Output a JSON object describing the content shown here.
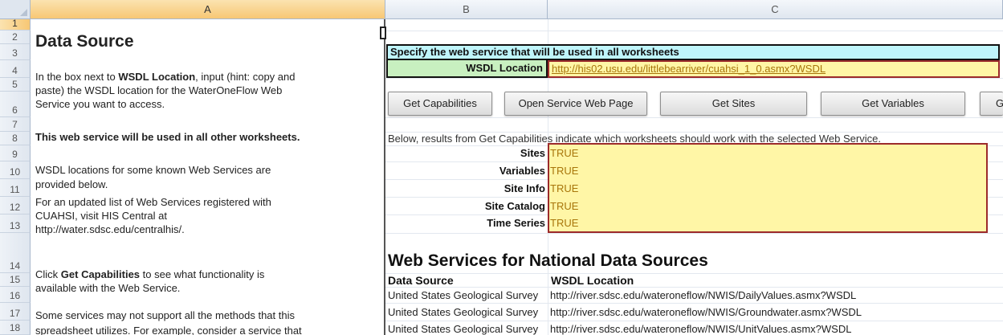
{
  "columns": [
    {
      "label": "A",
      "selected": true
    },
    {
      "label": "B",
      "selected": false
    },
    {
      "label": "C",
      "selected": false
    }
  ],
  "rows": [
    "1",
    "2",
    "3",
    "4",
    "5",
    "6",
    "7",
    "8",
    "9",
    "10",
    "11",
    "12",
    "13",
    "14",
    "15",
    "16",
    "17",
    "18"
  ],
  "left_panel": {
    "title": "Data Source",
    "para1_line1_pre": "In the box next to ",
    "para1_line1_bold": "WSDL Location",
    "para1_line1_post": ", input (hint: copy and",
    "para1_line2": "paste) the WSDL location for the WaterOneFlow  Web",
    "para1_line3": "Service you want to access.",
    "para2": "This web service will be used in all other worksheets.",
    "para3_line1": "WSDL locations for some known Web Services are",
    "para3_line2": "provided below.",
    "para4_line1": "For an updated list of Web Services registered with",
    "para4_line2": "CUAHSI, visit HIS Central at",
    "para4_line3": "http://water.sdsc.edu/centralhis/.",
    "para5_line1_pre": "Click ",
    "para5_line1_bold": "Get Capabilities",
    "para5_line1_post": " to see what functionality is",
    "para5_line2": "available with the Web Service.",
    "para6_line1": "Some services may not support all the methods that this",
    "para6_line2": "spreadsheet utilizes.  For example, consider a service that"
  },
  "banner": "Specify the web service that will be used in all worksheets",
  "wsdl": {
    "label": "WSDL Location",
    "value": "http://his02.usu.edu/littlebearriver/cuahsi_1_0.asmx?WSDL"
  },
  "buttons": {
    "get_capabilities": "Get Capabilities",
    "open_service_web_page": "Open Service Web Page",
    "get_sites": "Get Sites",
    "get_variables": "Get Variables",
    "get_site_info_partial": "Get S"
  },
  "below_text": "Below, results from Get Capabilities indicate which worksheets should work with the selected Web Service.",
  "capabilities": [
    {
      "label": "Sites",
      "value": "TRUE"
    },
    {
      "label": "Variables",
      "value": "TRUE"
    },
    {
      "label": "Site Info",
      "value": "TRUE"
    },
    {
      "label": "Site Catalog",
      "value": "TRUE"
    },
    {
      "label": "Time Series",
      "value": "TRUE"
    }
  ],
  "national": {
    "heading": "Web Services for National Data Sources",
    "col_source": "Data Source",
    "col_wsdl": "WSDL Location",
    "rows": [
      {
        "source": "United States Geological Survey",
        "wsdl": "http://river.sdsc.edu/wateroneflow/NWIS/DailyValues.asmx?WSDL"
      },
      {
        "source": "United States Geological Survey",
        "wsdl": "http://river.sdsc.edu/wateroneflow/NWIS/Groundwater.asmx?WSDL"
      },
      {
        "source": "United States Geological Survey",
        "wsdl": "http://river.sdsc.edu/wateroneflow/NWIS/UnitValues.asmx?WSDL"
      }
    ]
  },
  "colors": {
    "banner_fill": "#bff5fb",
    "label_fill": "#c8f0c0",
    "input_fill": "#fff6a6",
    "input_border": "#9c2b2b",
    "input_text": "#a8760a",
    "header_selected": "#f7c774"
  }
}
